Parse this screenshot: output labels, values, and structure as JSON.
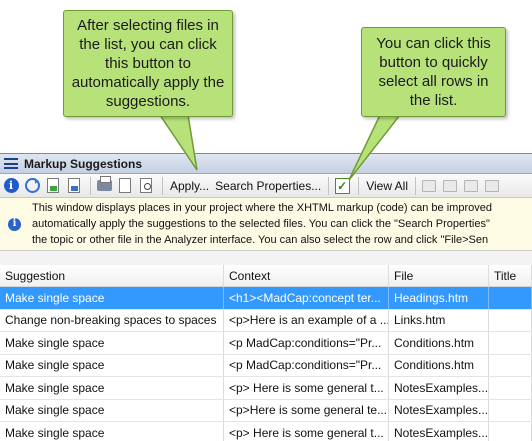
{
  "callouts": [
    {
      "text": "After selecting files in the list, you can click this button to automatically apply the suggestions."
    },
    {
      "text": "You can click this button to quickly select all rows in the list."
    }
  ],
  "window": {
    "title": "Markup Suggestions"
  },
  "toolbar": {
    "apply_label": "Apply...",
    "search_properties_label": "Search Properties...",
    "view_all_label": "View All"
  },
  "infobar": {
    "lines": [
      "This window displays places in your project where the XHTML markup (code) can be improved",
      "automatically apply the suggestions to the selected files. You can click the \"Search Properties\"",
      "the topic or other file in the Analyzer interface. You can also select the row and click \"File>Sen"
    ]
  },
  "grid": {
    "columns": [
      "Suggestion",
      "Context",
      "File",
      "Title"
    ],
    "rows": [
      {
        "suggestion": "Make single space",
        "context": "<h1><MadCap:concept ter...",
        "file": "Headings.htm",
        "title": "",
        "selected": true
      },
      {
        "suggestion": "Change non-breaking spaces to spaces",
        "context": "<p>Here is an example of a ...",
        "file": "Links.htm",
        "title": "",
        "selected": false
      },
      {
        "suggestion": "Make single space",
        "context": "<p MadCap:conditions=\"Pr...",
        "file": "Conditions.htm",
        "title": "",
        "selected": false
      },
      {
        "suggestion": "Make single space",
        "context": "<p MadCap:conditions=\"Pr...",
        "file": "Conditions.htm",
        "title": "",
        "selected": false
      },
      {
        "suggestion": "Make single space",
        "context": "<p> Here is some general t...",
        "file": "NotesExamples...",
        "title": "",
        "selected": false
      },
      {
        "suggestion": "Make single space",
        "context": "<p>Here is some general te...",
        "file": "NotesExamples...",
        "title": "",
        "selected": false
      },
      {
        "suggestion": "Make single space",
        "context": "<p> Here is some general t...",
        "file": "NotesExamples...",
        "title": "",
        "selected": false
      }
    ]
  },
  "colors": {
    "callout_fill": "#b7e27a",
    "selection": "#3399ff",
    "infobar_bg": "#fdfbe4"
  }
}
